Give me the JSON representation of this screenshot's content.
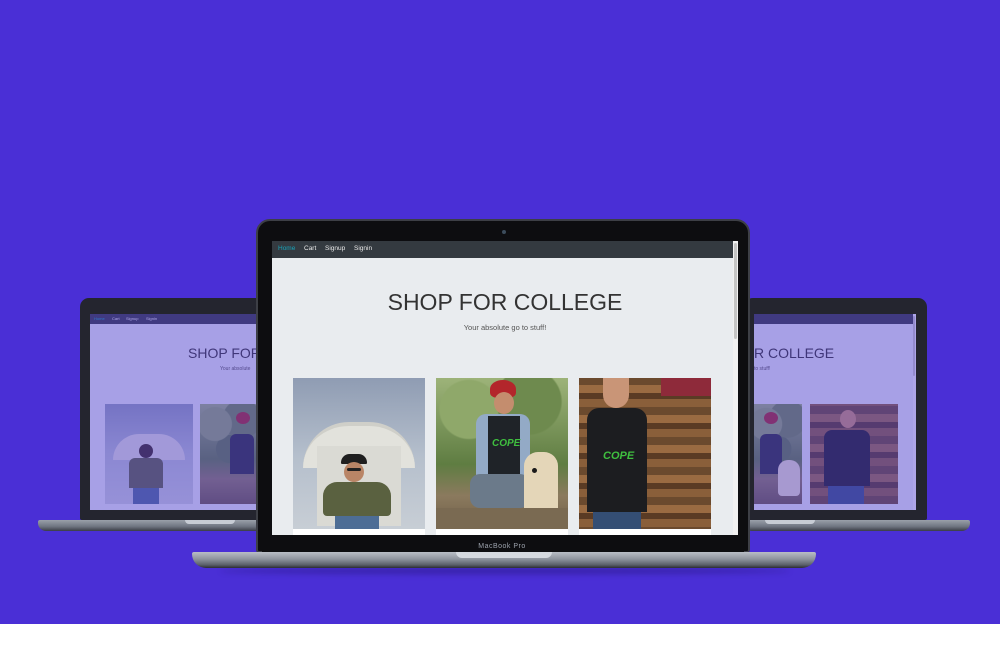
{
  "site": {
    "nav": [
      "Home",
      "Cart",
      "Signup",
      "Signin"
    ],
    "title": "SHOP FOR COLLEGE",
    "subtitle": "Your absolute go to stuff!"
  },
  "device": {
    "brand": "MacBook Pro"
  },
  "side_left": {
    "title_fragment": "SHOP FOR C"
  },
  "side_right": {
    "title_fragment": "R COLLEGE",
    "subtitle_fragment": "to stuff!"
  },
  "products": [
    {
      "name": "olive-hoodie-photo",
      "shirt_text": ""
    },
    {
      "name": "cope-tee-dog-photo",
      "shirt_text": "COPE"
    },
    {
      "name": "cope-tee-wood-photo",
      "shirt_text": "COPE"
    }
  ],
  "colors": {
    "background": "#4a2fd6",
    "navbar": "#343a40",
    "nav_active": "#17a2b8",
    "screen_bg": "#e9ecef",
    "cope_text": "#3fbf3f"
  }
}
